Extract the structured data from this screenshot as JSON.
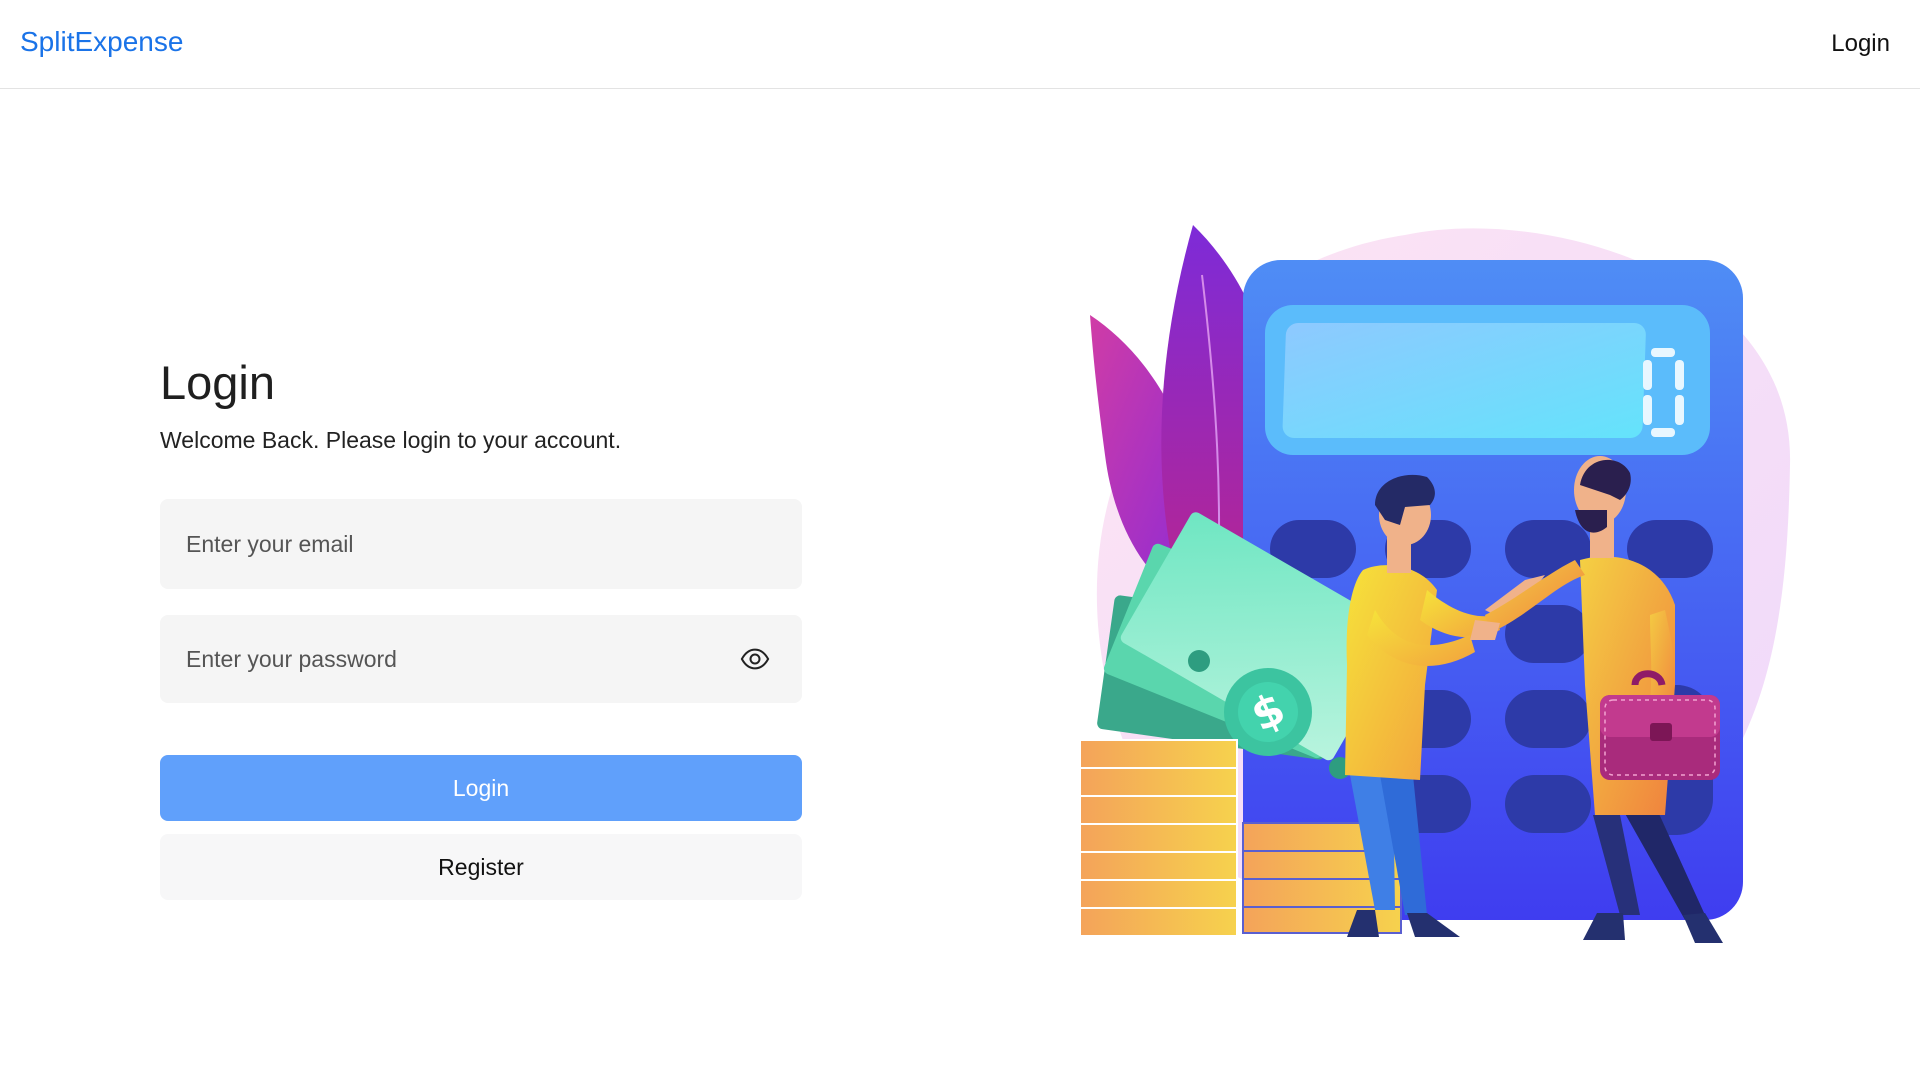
{
  "navbar": {
    "brand": "SplitExpense",
    "login_link": "Login"
  },
  "form": {
    "title": "Login",
    "subtitle": "Welcome Back. Please login to your account.",
    "email_placeholder": "Enter your email",
    "email_value": "",
    "password_placeholder": "Enter your password",
    "password_value": "",
    "password_toggle_icon": "eye-icon",
    "login_button": "Login",
    "register_button": "Register"
  },
  "illustration": {
    "calculator_display_digit": "0",
    "dollar_sign": "$",
    "icons": [
      "calculator",
      "banknotes",
      "coins",
      "leaves",
      "handshake",
      "briefcase"
    ]
  },
  "colors": {
    "brand": "#1a73e8",
    "login_button": "#60a0fb",
    "field_background": "#f5f5f5",
    "register_button": "#f7f7f8"
  }
}
